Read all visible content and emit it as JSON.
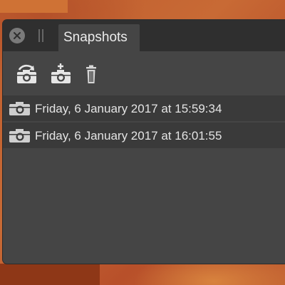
{
  "panel": {
    "title": "Snapshots",
    "close_icon": "close-icon",
    "toolbar": [
      {
        "name": "restore-snapshot-button",
        "icon": "camera-restore-icon"
      },
      {
        "name": "add-snapshot-button",
        "icon": "camera-add-icon"
      },
      {
        "name": "delete-snapshot-button",
        "icon": "trash-icon"
      }
    ],
    "snapshots": [
      {
        "label": "Friday, 6 January 2017 at 15:59:34",
        "icon": "camera-icon"
      },
      {
        "label": "Friday, 6 January 2017 at 16:01:55",
        "icon": "camera-icon"
      }
    ]
  },
  "colors": {
    "panel_bg": "#454545",
    "titlebar_bg": "#2f2f2f",
    "row_bg": "#3a3a3a",
    "text": "#e4e4e4"
  }
}
